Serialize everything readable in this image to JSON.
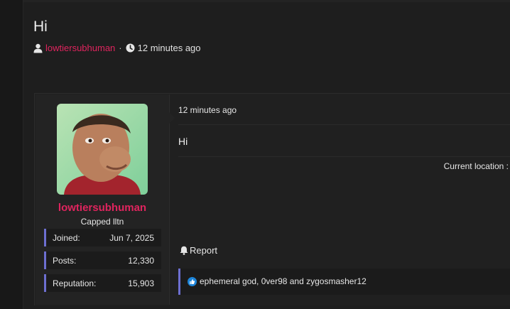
{
  "thread": {
    "title": "Hi",
    "author": "lowtiersubhuman",
    "separator": "·",
    "time": "12 minutes ago"
  },
  "post": {
    "user": {
      "name": "lowtiersubhuman",
      "title": "Capped lltn",
      "stats": [
        {
          "label": "Joined:",
          "value": "Jun 7, 2025"
        },
        {
          "label": "Posts:",
          "value": "12,330"
        },
        {
          "label": "Reputation:",
          "value": "15,903"
        }
      ]
    },
    "time": "12 minutes ago",
    "body": "Hi",
    "location_label": "Current location :",
    "report_label": "Report",
    "likes_text": "ephemeral god, 0ver98 and zygosmasher12"
  },
  "colors": {
    "accent": "#e0245e",
    "stat_border": "#6d6fd0",
    "like_icon": "#1d84d8"
  },
  "icons": [
    "user-icon",
    "clock-icon",
    "bell-icon",
    "thumbs-up-icon"
  ]
}
